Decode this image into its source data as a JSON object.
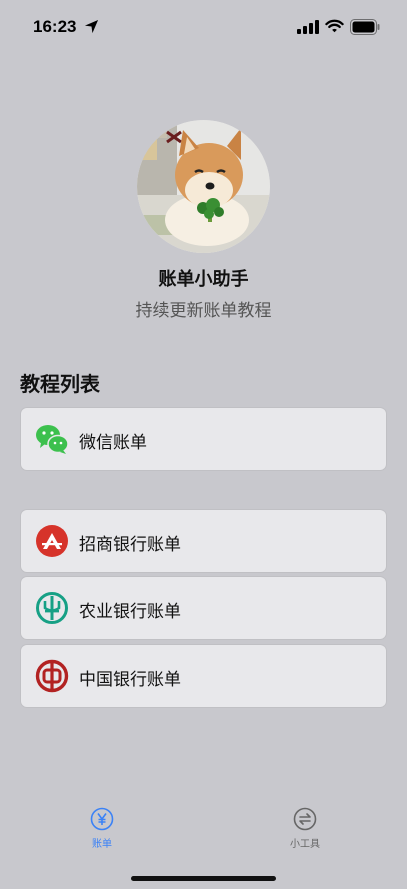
{
  "status_bar": {
    "time": "16:23"
  },
  "profile": {
    "name": "账单小助手",
    "subtitle": "持续更新账单教程"
  },
  "section": {
    "title": "教程列表"
  },
  "list_items": [
    {
      "label": "微信账单",
      "icon": "wechat-icon",
      "color": "#3cc04d"
    },
    {
      "label": "招商银行账单",
      "icon": "cmb-logo-icon",
      "color": "#d6332a"
    },
    {
      "label": "农业银行账单",
      "icon": "abc-logo-icon",
      "color": "#16a085"
    },
    {
      "label": "中国银行账单",
      "icon": "boc-logo-icon",
      "color": "#b22222"
    }
  ],
  "tab_bar": {
    "tabs": [
      {
        "label": "账单",
        "icon": "yen-icon",
        "active": true
      },
      {
        "label": "小工具",
        "icon": "swap-icon",
        "active": false
      }
    ],
    "accent_color": "#3b82f6"
  }
}
